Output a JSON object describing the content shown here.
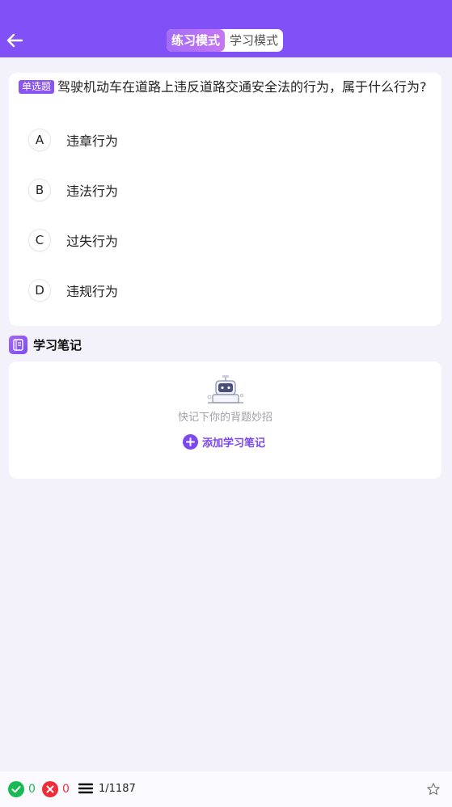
{
  "header": {
    "back_icon": "arrow-left-icon",
    "tabs": [
      {
        "label": "练习模式",
        "active": true
      },
      {
        "label": "学习模式",
        "active": false
      }
    ],
    "bg_color": "#8250f7"
  },
  "question": {
    "type_badge": "单选题",
    "text": "驾驶机动车在道路上违反道路交通安全法的行为，属于什么行为?",
    "options": [
      {
        "letter": "A",
        "text": "违章行为"
      },
      {
        "letter": "B",
        "text": "违法行为"
      },
      {
        "letter": "C",
        "text": "过失行为"
      },
      {
        "letter": "D",
        "text": "违规行为"
      }
    ]
  },
  "notes": {
    "title": "学习笔记",
    "hint": "快记下你的背题妙招",
    "add_label": "添加学习笔记",
    "icon": "notebook-icon",
    "illustration": "robot-illustration"
  },
  "footer": {
    "correct_count": "0",
    "wrong_count": "0",
    "progress": "1/1187",
    "correct_color": "#1bb954",
    "wrong_color": "#ee2d3a",
    "icons": [
      "check-circle-icon",
      "x-circle-icon",
      "list-icon",
      "star-outline-icon"
    ]
  }
}
